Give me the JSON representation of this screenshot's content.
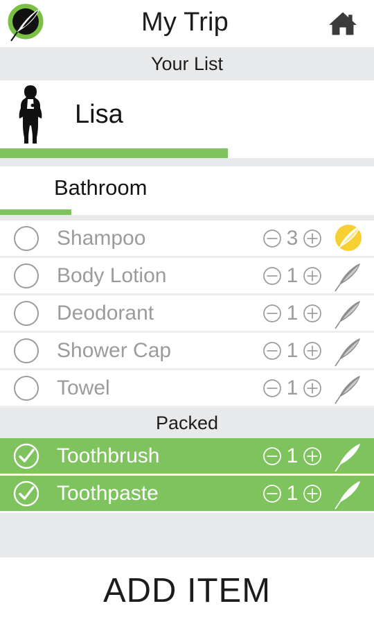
{
  "header": {
    "title": "My Trip",
    "logo_icon": "quill-circle-logo-icon",
    "home_icon": "home-icon"
  },
  "list_strip": {
    "label": "Your List"
  },
  "traveler": {
    "name": "Lisa",
    "avatar_icon": "person-silhouette-icon",
    "progress_percent": 61
  },
  "category": {
    "name": "Bathroom",
    "progress_percent": 19
  },
  "items": [
    {
      "name": "Shampoo",
      "quantity": "3",
      "checked": false,
      "edit_icon": "quill-highlighted-icon",
      "edit_active": true
    },
    {
      "name": "Body Lotion",
      "quantity": "1",
      "checked": false,
      "edit_icon": "quill-icon",
      "edit_active": false
    },
    {
      "name": "Deodorant",
      "quantity": "1",
      "checked": false,
      "edit_icon": "quill-icon",
      "edit_active": false
    },
    {
      "name": "Shower Cap",
      "quantity": "1",
      "checked": false,
      "edit_icon": "quill-icon",
      "edit_active": false
    },
    {
      "name": "Towel",
      "quantity": "1",
      "checked": false,
      "edit_icon": "quill-icon",
      "edit_active": false
    }
  ],
  "packed_strip": {
    "label": "Packed"
  },
  "packed_items": [
    {
      "name": "Toothbrush",
      "quantity": "1",
      "checked": true,
      "edit_icon": "quill-icon",
      "edit_active": false
    },
    {
      "name": "Toothpaste",
      "quantity": "1",
      "checked": true,
      "edit_icon": "quill-icon",
      "edit_active": false
    }
  ],
  "stepper": {
    "decrement_icon": "circled-minus-icon",
    "increment_icon": "circled-plus-icon"
  },
  "footer": {
    "add_item_label": "ADD ITEM"
  },
  "colors": {
    "accent_green": "#7fc35e",
    "strip_gray": "#e8e9eb",
    "muted_text": "#9b9b9b",
    "dark_text": "#1c1c1c",
    "highlight_yellow": "#f6d032"
  }
}
